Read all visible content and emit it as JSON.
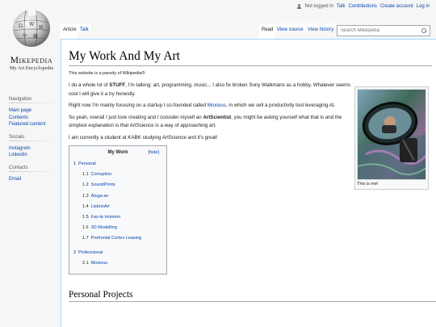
{
  "personal_tools": {
    "status": "Not logged in",
    "links": [
      "Talk",
      "Contributions",
      "Create account",
      "Log in"
    ]
  },
  "logo": {
    "wordmark": "Mikepedia",
    "tagline": "My Art Encyclopedia"
  },
  "sidebar": {
    "navigation": {
      "heading": "Navigation",
      "items": [
        "Main page",
        "Contents",
        "Featured content"
      ]
    },
    "socials": {
      "heading": "Socials",
      "items": [
        "Instagram",
        "LinkedIn"
      ]
    },
    "contacts": {
      "heading": "Contacts",
      "items": [
        "Email"
      ]
    }
  },
  "tabs": {
    "article": "Article",
    "talk": "Talk",
    "read": "Read",
    "view_source": "View source",
    "view_history": "View history"
  },
  "search": {
    "placeholder": "Search Mikepedia"
  },
  "page": {
    "title": "My Work And My Art",
    "tagline": "This website is a parody of Wikipedia®",
    "p1": {
      "a": "I do a whole lot of ",
      "b": "STUFF",
      "c": ", I'm talking: art, programming, music... I also fix broken Sony Walkmans as a hobby. Whatever seems cool I will give it a try honestly."
    },
    "p2": {
      "a": "Right now I'm mainly focusing on a startup I co-founded called ",
      "link": "Moxious",
      "b": ", in which we sell a productivity tool leveraging AI."
    },
    "p3": {
      "a": "So yeah, overall I just love creating and I consider myself an ",
      "b": "ArtScientist",
      "c": ", you might be asking yourself what that is and the simplest explanation is that ArtScience is a way of approaching art."
    },
    "p4": "I am currently a student at KABK studying ArtScience and it's great!",
    "image_caption": "This is me!",
    "toc": {
      "title": "My Work",
      "toggle": "[hide]",
      "sections": [
        {
          "num": "1",
          "label": "Personal",
          "children": [
            {
              "num": "1.1",
              "label": "Corruption"
            },
            {
              "num": "1.2",
              "label": "SoundPrints"
            },
            {
              "num": "1.3",
              "label": "Aluga-se"
            },
            {
              "num": "1.4",
              "label": "LisbonAir"
            },
            {
              "num": "1.5",
              "label": "Faz-te Homem"
            },
            {
              "num": "1.6",
              "label": "3D Modelling"
            },
            {
              "num": "1.7",
              "label": "Prefrontal Cortex Leasing"
            }
          ]
        },
        {
          "num": "2",
          "label": "Professional",
          "children": [
            {
              "num": "2.1",
              "label": "Moxious"
            }
          ]
        }
      ]
    },
    "section_heading": "Personal Projects"
  }
}
